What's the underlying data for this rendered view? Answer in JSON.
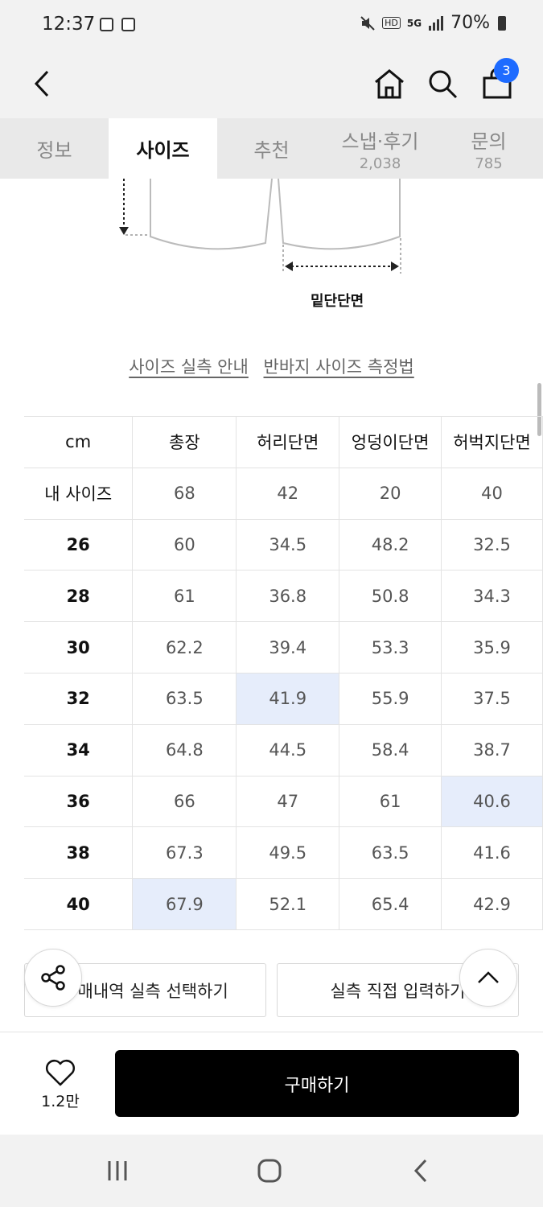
{
  "status_bar": {
    "time": "12:37",
    "signal": "5G",
    "battery": "70%"
  },
  "header": {
    "cart_count": "3"
  },
  "tabs": [
    {
      "label": "정보",
      "count": ""
    },
    {
      "label": "사이즈",
      "count": ""
    },
    {
      "label": "추천",
      "count": ""
    },
    {
      "label": "스냅·후기",
      "count": "2,038"
    },
    {
      "label": "문의",
      "count": "785"
    }
  ],
  "active_tab": "사이즈",
  "diagram": {
    "label": "밑단단면"
  },
  "guides": {
    "actual_size": "사이즈 실측 안내",
    "shorts_method": "반바지 사이즈 측정법"
  },
  "size_table": {
    "headers": [
      "cm",
      "총장",
      "허리단면",
      "엉덩이단면",
      "허벅지단면"
    ],
    "rows": [
      [
        "내 사이즈",
        "68",
        "42",
        "20",
        "40"
      ],
      [
        "26",
        "60",
        "34.5",
        "48.2",
        "32.5"
      ],
      [
        "28",
        "61",
        "36.8",
        "50.8",
        "34.3"
      ],
      [
        "30",
        "62.2",
        "39.4",
        "53.3",
        "35.9"
      ],
      [
        "32",
        "63.5",
        "41.9",
        "55.9",
        "37.5"
      ],
      [
        "34",
        "64.8",
        "44.5",
        "58.4",
        "38.7"
      ],
      [
        "36",
        "66",
        "47",
        "61",
        "40.6"
      ],
      [
        "38",
        "67.3",
        "49.5",
        "63.5",
        "41.6"
      ],
      [
        "40",
        "67.9",
        "52.1",
        "65.4",
        "42.9"
      ]
    ],
    "highlight_color": "#e6edfb"
  },
  "buttons": {
    "purchase_history": "구매내역 실측 선택하기",
    "direct_input": "실측 직접 입력하기",
    "buy": "구매하기"
  },
  "like": {
    "count": "1.2만"
  },
  "colors": {
    "accent": "#1e6bff",
    "buy_button": "#000000",
    "highlight": "#e6edfb"
  }
}
